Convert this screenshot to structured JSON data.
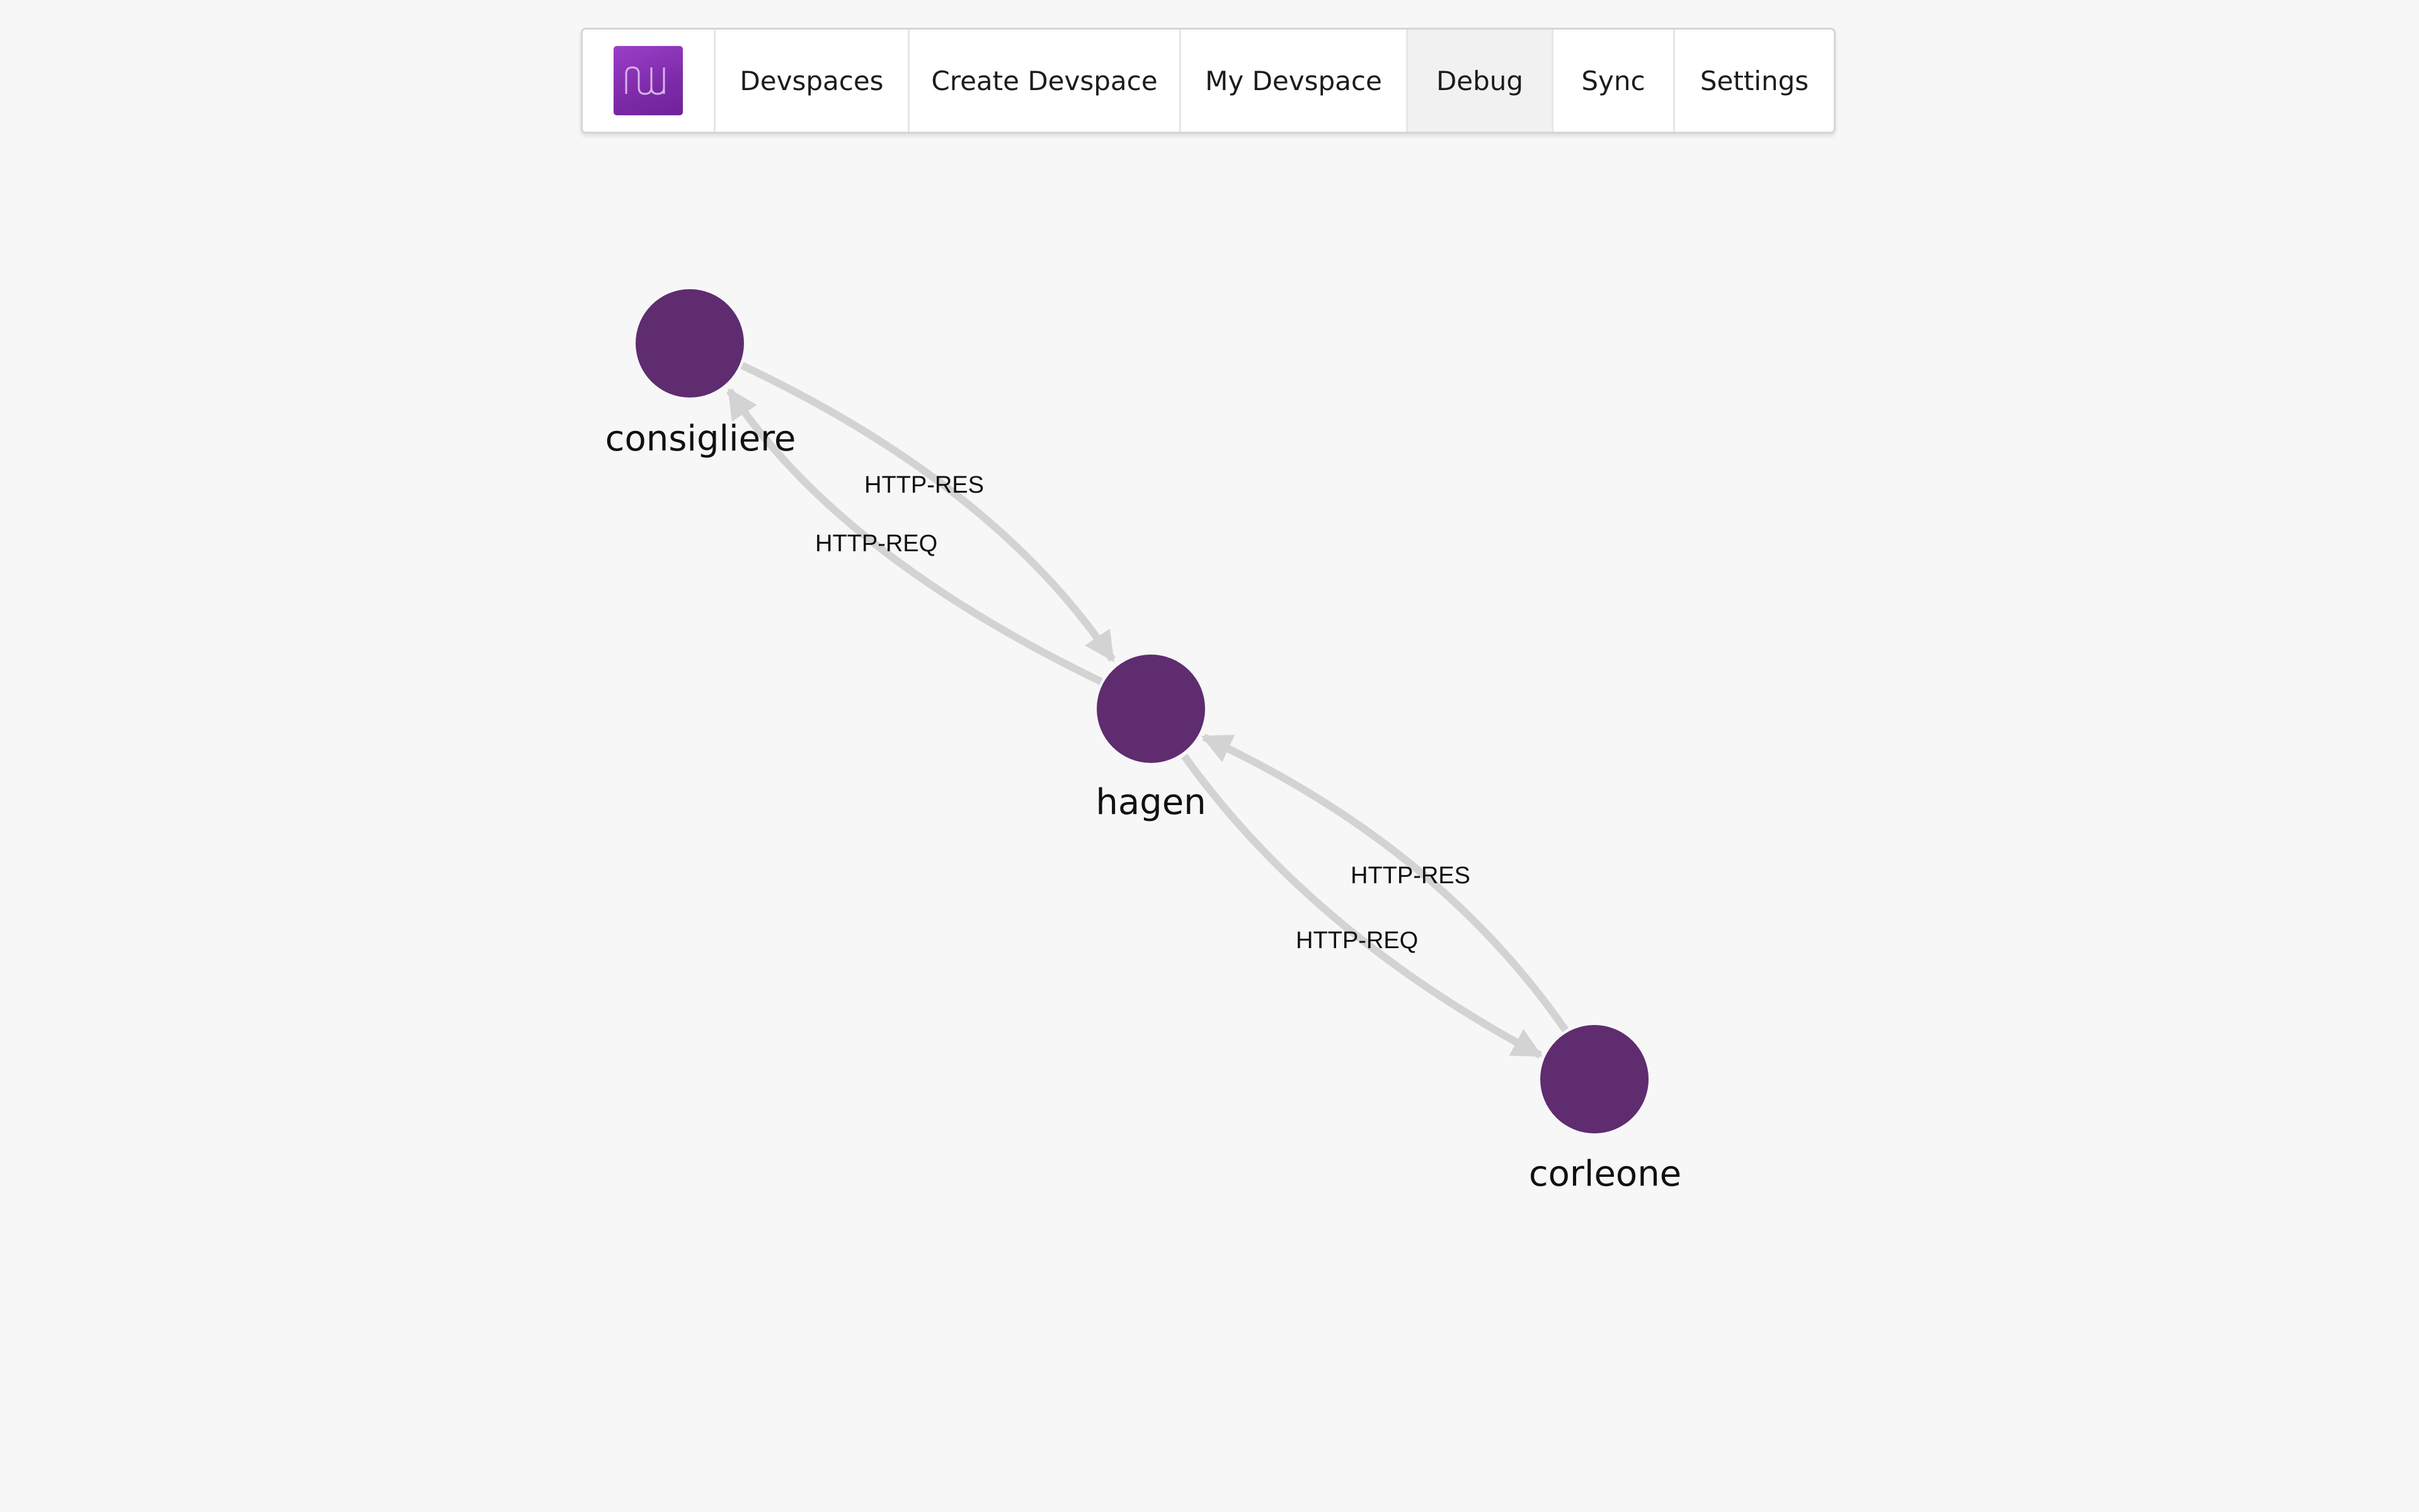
{
  "nav": {
    "logo_icon": "nuvo-logo-icon",
    "items": [
      {
        "label": "Devspaces"
      },
      {
        "label": "Create Devspace"
      },
      {
        "label": "My Devspace"
      },
      {
        "label": "Debug",
        "active": true
      },
      {
        "label": "Sync"
      },
      {
        "label": "Settings"
      }
    ],
    "colors": {
      "logo_gradient_start": "#9b3fc9",
      "logo_gradient_end": "#6e2398",
      "active_background": "#f1f1f1"
    }
  },
  "graph": {
    "node_color": "#5f2c6f",
    "edge_color": "#d3d3d3",
    "nodes": [
      {
        "id": "consigliere",
        "label": "consigliere"
      },
      {
        "id": "hagen",
        "label": "hagen"
      },
      {
        "id": "corleone",
        "label": "corleone"
      }
    ],
    "edges": [
      {
        "from": "consigliere",
        "to": "hagen",
        "label": "HTTP-RES"
      },
      {
        "from": "hagen",
        "to": "consigliere",
        "label": "HTTP-REQ"
      },
      {
        "from": "corleone",
        "to": "hagen",
        "label": "HTTP-RES"
      },
      {
        "from": "hagen",
        "to": "corleone",
        "label": "HTTP-REQ"
      }
    ]
  }
}
